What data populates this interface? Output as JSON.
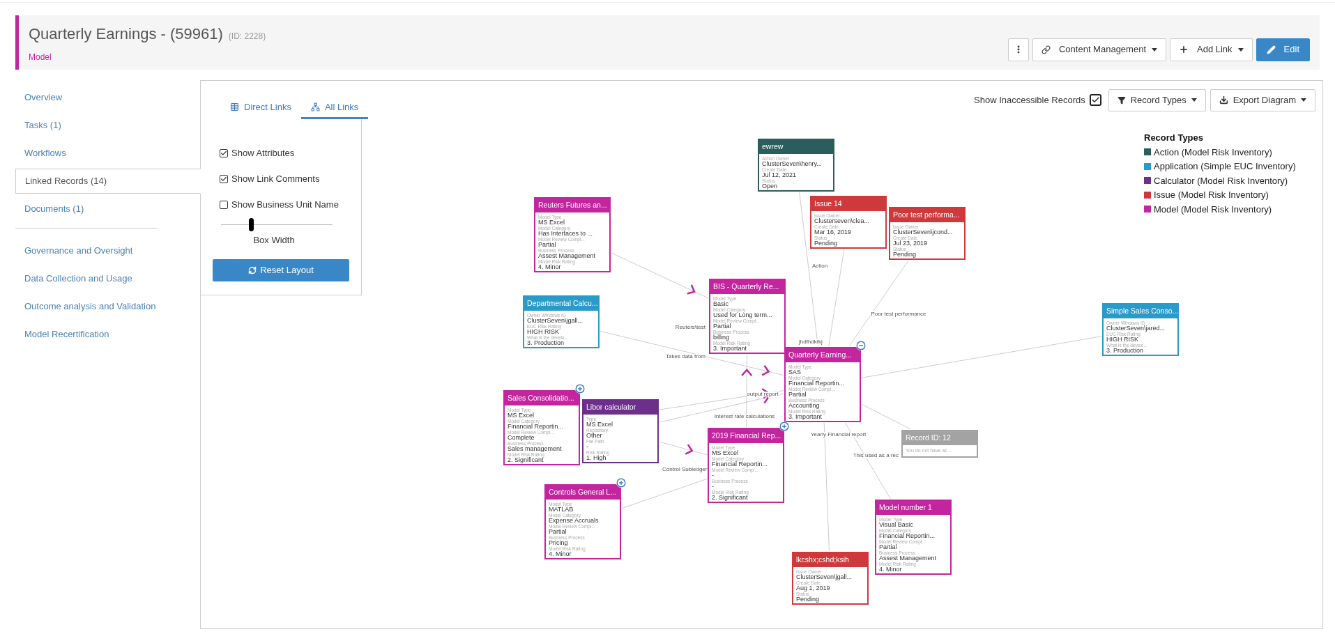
{
  "header": {
    "title": "Quarterly Earnings - (59961)",
    "id": "(ID: 2228)",
    "subtitle": "Model",
    "buttons": [
      {
        "kind": "more"
      },
      {
        "kind": "link",
        "label": "Content Management"
      },
      {
        "kind": "add",
        "label": "Add Link"
      },
      {
        "kind": "edit",
        "label": "Edit"
      }
    ]
  },
  "sidebar": {
    "groups": [
      [
        {
          "label": "Overview",
          "selected": false
        },
        {
          "label": "Tasks (1)",
          "selected": false
        },
        {
          "label": "Workflows",
          "selected": false
        },
        {
          "label": "Linked Records (14)",
          "selected": true
        },
        {
          "label": "Documents (1)",
          "selected": false
        }
      ],
      [
        {
          "label": "Governance and Oversight",
          "selected": false
        },
        {
          "label": "Data Collection and Usage",
          "selected": false
        },
        {
          "label": "Outcome analysis and Validation",
          "selected": false
        },
        {
          "label": "Model Recertification",
          "selected": false
        }
      ]
    ]
  },
  "tabs": [
    {
      "label": "Direct Links",
      "kind": "table",
      "selected": false
    },
    {
      "label": "All Links",
      "kind": "tree",
      "selected": true
    }
  ],
  "toolbar": {
    "inaccessible": {
      "label": "Show Inaccessible Records",
      "checked": true
    },
    "buttons": [
      {
        "kind": "filter",
        "label": "Record Types"
      },
      {
        "kind": "export",
        "label": "Export Diagram"
      }
    ]
  },
  "options": {
    "checkboxes": [
      {
        "label": "Show Attributes",
        "checked": true
      },
      {
        "label": "Show Link Comments",
        "checked": true
      },
      {
        "label": "Show Business Unit Name",
        "checked": false
      }
    ],
    "slider": {
      "label": "Box Width",
      "level": 0.27
    },
    "reset": "Reset Layout"
  },
  "legend": {
    "title": "Record Types",
    "items": [
      {
        "kind": "action",
        "label": "Action (Model Risk Inventory)",
        "color": "#2a5e5c"
      },
      {
        "kind": "application",
        "label": "Application (Simple EUC Inventory)",
        "color": "#2a9ac9"
      },
      {
        "kind": "calculator",
        "label": "Calculator (Model Risk Inventory)",
        "color": "#6d2f8c"
      },
      {
        "kind": "issue",
        "label": "Issue (Model Risk Inventory)",
        "color": "#d0393c"
      },
      {
        "kind": "model",
        "label": "Model (Model Risk Inventory)",
        "color": "#c3259f"
      }
    ]
  },
  "nodes": [
    {
      "title": "ewrew",
      "kind": "action",
      "fields": [
        {
          "label": "Action Owner",
          "value": "ClusterSeven\\henry..."
        },
        {
          "label": "Create Date",
          "value": "Jul 12, 2021"
        },
        {
          "label": "Status",
          "value": "Open"
        }
      ]
    },
    {
      "title": "Reuters Futures an...",
      "kind": "model",
      "fields": [
        {
          "label": "Model Type",
          "value": "MS Excel"
        },
        {
          "label": "Model Category",
          "value": "Has Interfaces to ..."
        },
        {
          "label": "Model Review Compl...",
          "value": "Partial"
        },
        {
          "label": "Business Process",
          "value": "Assest Management"
        },
        {
          "label": "Model Risk Rating",
          "value": "4. Minor"
        }
      ]
    },
    {
      "title": "Issue 14",
      "kind": "issue",
      "fields": [
        {
          "label": "Issue Owner",
          "value": "Clusterseven\\clea..."
        },
        {
          "label": "Create Date",
          "value": "Mar 16, 2019"
        },
        {
          "label": "Status",
          "value": "Pending"
        }
      ]
    },
    {
      "title": "Poor test performa...",
      "kind": "issue",
      "fields": [
        {
          "label": "Issue Owner",
          "value": "ClusterSeven\\jcond..."
        },
        {
          "label": "Create Date",
          "value": "Jul 23, 2019"
        },
        {
          "label": "Status",
          "value": "Pending"
        }
      ]
    },
    {
      "title": "Departmental Calcu...",
      "kind": "application",
      "fields": [
        {
          "label": "Owner Windows ID",
          "value": "ClusterSeven\\jgall..."
        },
        {
          "label": "EUC Risk Rating",
          "value": "HIGH RISK"
        },
        {
          "label": "What is the develo...",
          "value": "3. Production"
        }
      ]
    },
    {
      "title": "BIS - Quarterly Re...",
      "kind": "model",
      "fields": [
        {
          "label": "Model Type",
          "value": "Basic"
        },
        {
          "label": "Model Category",
          "value": "Used for Long term..."
        },
        {
          "label": "Model Review Compl...",
          "value": "Partial"
        },
        {
          "label": "Business Process",
          "value": "billing"
        },
        {
          "label": "Model Risk Rating",
          "value": "3. Important"
        }
      ]
    },
    {
      "title": "Simple Sales Conso...",
      "kind": "application",
      "fields": [
        {
          "label": "Owner Windows ID",
          "value": "ClusterSeven\\jared..."
        },
        {
          "label": "EUC Risk Rating",
          "value": "HIGH RISK"
        },
        {
          "label": "What is the develo...",
          "value": "3. Production"
        }
      ]
    },
    {
      "title": "Quarterly Earning...",
      "kind": "model",
      "expanded": true,
      "fields": [
        {
          "label": "Model Type",
          "value": "SAS"
        },
        {
          "label": "Model Category",
          "value": "Financial Reportin..."
        },
        {
          "label": "Model Review Compl...",
          "value": "Partial"
        },
        {
          "label": "Business Process",
          "value": "Accounting"
        },
        {
          "label": "Model Risk Rating",
          "value": "3. Important"
        }
      ]
    },
    {
      "title": "Sales Consolidatio...",
      "kind": "model",
      "expanded": false,
      "fields": [
        {
          "label": "Model Type",
          "value": "MS Excel"
        },
        {
          "label": "Model Category",
          "value": "Financial Reportin..."
        },
        {
          "label": "Model Review Compl...",
          "value": "Complete"
        },
        {
          "label": "Business Process",
          "value": "Sales management"
        },
        {
          "label": "Model Risk Rating",
          "value": "2. Significant"
        }
      ]
    },
    {
      "title": "Libor calculator",
      "kind": "calculator",
      "fields": [
        {
          "label": "Type",
          "value": "MS Excel"
        },
        {
          "label": "Repository",
          "value": "Other"
        },
        {
          "label": "File Path",
          "value": "-"
        },
        {
          "label": "Risk Rating",
          "value": "1. High"
        }
      ]
    },
    {
      "title": "2019 Financial Rep...",
      "kind": "model",
      "expanded": false,
      "fields": [
        {
          "label": "Model Type",
          "value": "MS Excel"
        },
        {
          "label": "Model Category",
          "value": "Financial Reportin..."
        },
        {
          "label": "Model Review Compl...",
          "value": "-"
        },
        {
          "label": "Business Process",
          "value": "-"
        },
        {
          "label": "Model Risk Rating",
          "value": "2. Significant"
        }
      ]
    },
    {
      "title": "Record ID: 12",
      "kind": "inaccessible",
      "note": "You do not have ac..."
    },
    {
      "title": "Controls General L...",
      "kind": "model",
      "expanded": false,
      "fields": [
        {
          "label": "Model Type",
          "value": "MATLAB"
        },
        {
          "label": "Model Category",
          "value": "Expense Accruals"
        },
        {
          "label": "Model Review Compl...",
          "value": "Partial"
        },
        {
          "label": "Business Process",
          "value": "Pricing"
        },
        {
          "label": "Model Risk Rating",
          "value": "4. Minor"
        }
      ]
    },
    {
      "title": "Model number 1",
      "kind": "model",
      "fields": [
        {
          "label": "Model Type",
          "value": "Visual Basic"
        },
        {
          "label": "Model Category",
          "value": "Financial Reportin..."
        },
        {
          "label": "Model Review Compl...",
          "value": "Partial"
        },
        {
          "label": "Business Process",
          "value": "Assest Management"
        },
        {
          "label": "Model Risk Rating",
          "value": "4. Minor"
        }
      ]
    },
    {
      "title": "lkcshx;cshd;ksih",
      "kind": "issue",
      "fields": [
        {
          "label": "Issue Owner",
          "value": "ClusterSeven\\jgall..."
        },
        {
          "label": "Create Date",
          "value": "Aug 1, 2019"
        },
        {
          "label": "Status",
          "value": "Pending"
        }
      ]
    }
  ],
  "edges": [
    {
      "arrow": false,
      "label": "Action"
    },
    {
      "arrow": false
    },
    {
      "arrow": false,
      "label": "Poor test performance"
    },
    {
      "arrow": true,
      "label": "Reuters\\test"
    },
    {
      "arrow": true,
      "label": "Takes data from"
    },
    {
      "arrow": false
    },
    {
      "arrow": false,
      "label": "jhdfhdkfkj"
    },
    {
      "arrow": true,
      "label": "output report"
    },
    {
      "arrow": true
    },
    {
      "arrow": true,
      "label": "Interest rate calculations"
    },
    {
      "arrow": true,
      "label": "Control Subledger"
    },
    {
      "arrow": false
    },
    {
      "arrow": false,
      "label": "Yearly Financial report"
    },
    {
      "arrow": false,
      "label": "This used as a rec"
    },
    {
      "arrow": false
    },
    {
      "arrow": false
    }
  ]
}
